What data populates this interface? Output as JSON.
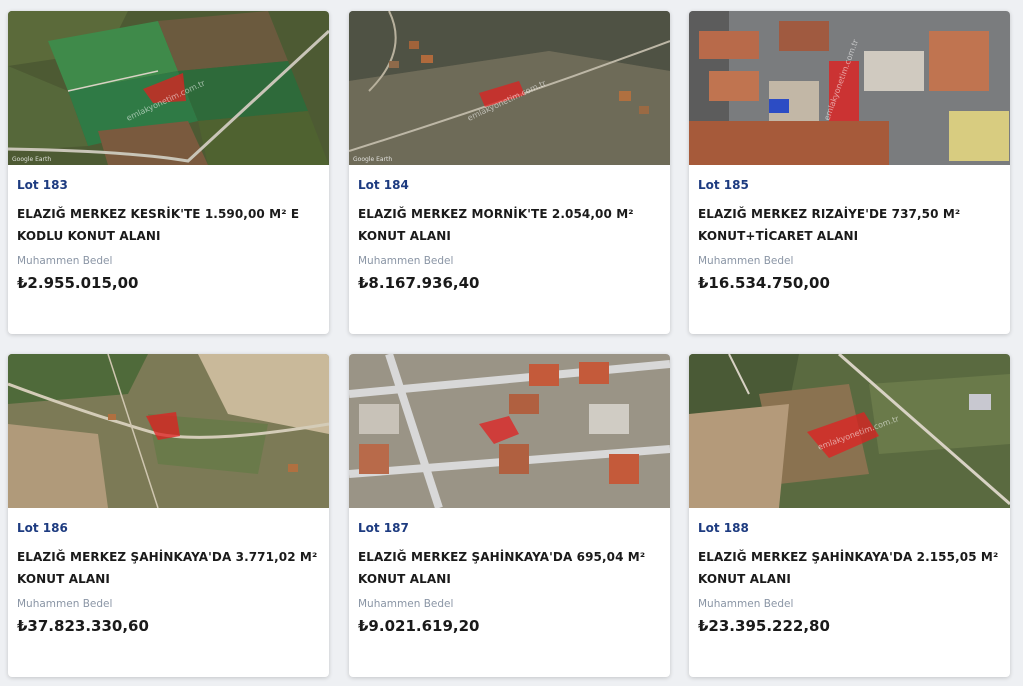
{
  "price_label": "Muhammen Bedel",
  "watermark": "emlakyonetim.com.tr",
  "map_credit": "Google Earth",
  "colors": {
    "lot": "#1d3b80",
    "parcel": "#e02020"
  },
  "lots": [
    {
      "lot": "Lot 183",
      "title": "ELAZIĞ MERKEZ KESRİK'TE 1.590,00 M² E KODLU KONUT ALANI",
      "price": "₺2.955.015,00"
    },
    {
      "lot": "Lot 184",
      "title": "ELAZIĞ MERKEZ MORNİK'TE 2.054,00 M² KONUT ALANI",
      "price": "₺8.167.936,40"
    },
    {
      "lot": "Lot 185",
      "title": "ELAZIĞ MERKEZ RIZAİYE'DE 737,50 M² KONUT+TİCARET ALANI",
      "price": "₺16.534.750,00"
    },
    {
      "lot": "Lot 186",
      "title": "ELAZIĞ MERKEZ ŞAHİNKAYA'DA 3.771,02 M² KONUT ALANI",
      "price": "₺37.823.330,60"
    },
    {
      "lot": "Lot 187",
      "title": "ELAZIĞ MERKEZ ŞAHİNKAYA'DA 695,04 M² KONUT ALANI",
      "price": "₺9.021.619,20"
    },
    {
      "lot": "Lot 188",
      "title": "ELAZIĞ MERKEZ ŞAHİNKAYA'DA 2.155,05 M² KONUT ALANI",
      "price": "₺23.395.222,80"
    }
  ]
}
